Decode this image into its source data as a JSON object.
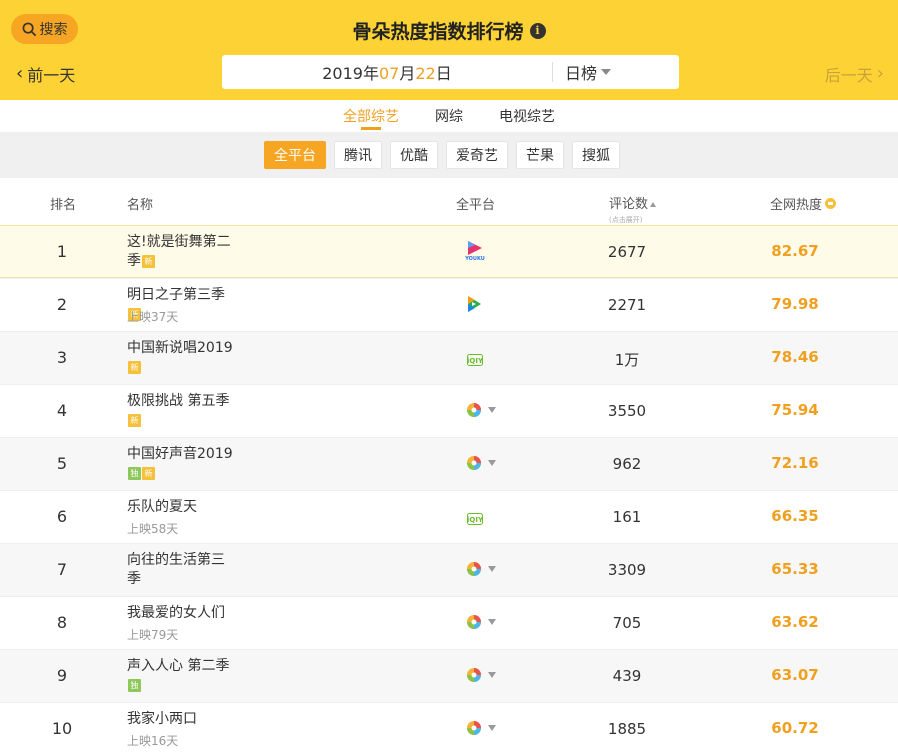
{
  "header": {
    "search_label": "搜索",
    "title": "骨朵热度指数排行榜",
    "info_icon": "i",
    "prev_label": "前一天",
    "next_label": "后一天",
    "date": {
      "year": "2019",
      "year_unit": "年",
      "month": "07",
      "month_unit": "月",
      "day": "22",
      "day_unit": "日"
    },
    "range_label": "日榜",
    "colors": {
      "brand": "#fdd235",
      "accent": "#f0a020"
    }
  },
  "tabs": [
    {
      "label": "全部综艺",
      "active": true
    },
    {
      "label": "网综",
      "active": false
    },
    {
      "label": "电视综艺",
      "active": false
    }
  ],
  "platforms": [
    {
      "label": "全平台",
      "active": true
    },
    {
      "label": "腾讯",
      "active": false
    },
    {
      "label": "优酷",
      "active": false
    },
    {
      "label": "爱奇艺",
      "active": false
    },
    {
      "label": "芒果",
      "active": false
    },
    {
      "label": "搜狐",
      "active": false
    }
  ],
  "table": {
    "headers": {
      "rank": "排名",
      "name": "名称",
      "platform": "全平台",
      "comments": "评论数",
      "comments_hint": "(点击展开)",
      "heat": "全网热度"
    },
    "rows": [
      {
        "rank": "1",
        "name": "这!就是街舞第二季",
        "badges": [
          "new"
        ],
        "sub": "",
        "platform": "youku",
        "multi": false,
        "comments": "2677",
        "heat": "82.67"
      },
      {
        "rank": "2",
        "name": "明日之子第三季",
        "badges": [
          "new"
        ],
        "sub": "上映37天",
        "platform": "tencent",
        "multi": false,
        "comments": "2271",
        "heat": "79.98"
      },
      {
        "rank": "3",
        "name": "中国新说唱2019",
        "badges": [
          "new"
        ],
        "sub": "",
        "platform": "iqiyi",
        "multi": false,
        "comments": "1万",
        "heat": "78.46"
      },
      {
        "rank": "4",
        "name": "极限挑战 第五季",
        "badges": [
          "new"
        ],
        "sub": "",
        "platform": "multi",
        "multi": true,
        "comments": "3550",
        "heat": "75.94"
      },
      {
        "rank": "5",
        "name": "中国好声音2019",
        "badges": [
          "green",
          "new"
        ],
        "sub": "",
        "platform": "multi",
        "multi": true,
        "comments": "962",
        "heat": "72.16"
      },
      {
        "rank": "6",
        "name": "乐队的夏天",
        "badges": [],
        "sub": "上映58天",
        "platform": "iqiyi",
        "multi": false,
        "comments": "161",
        "heat": "66.35"
      },
      {
        "rank": "7",
        "name": "向往的生活第三季",
        "badges": [],
        "sub": "",
        "platform": "multi",
        "multi": true,
        "comments": "3309",
        "heat": "65.33"
      },
      {
        "rank": "8",
        "name": "我最爱的女人们",
        "badges": [],
        "sub": "上映79天",
        "platform": "multi",
        "multi": true,
        "comments": "705",
        "heat": "63.62"
      },
      {
        "rank": "9",
        "name": "声入人心 第二季",
        "badges": [
          "green"
        ],
        "sub": "",
        "platform": "multi",
        "multi": true,
        "comments": "439",
        "heat": "63.07"
      },
      {
        "rank": "10",
        "name": "我家小两口",
        "badges": [],
        "sub": "上映16天",
        "platform": "multi",
        "multi": true,
        "comments": "1885",
        "heat": "60.72"
      }
    ]
  }
}
